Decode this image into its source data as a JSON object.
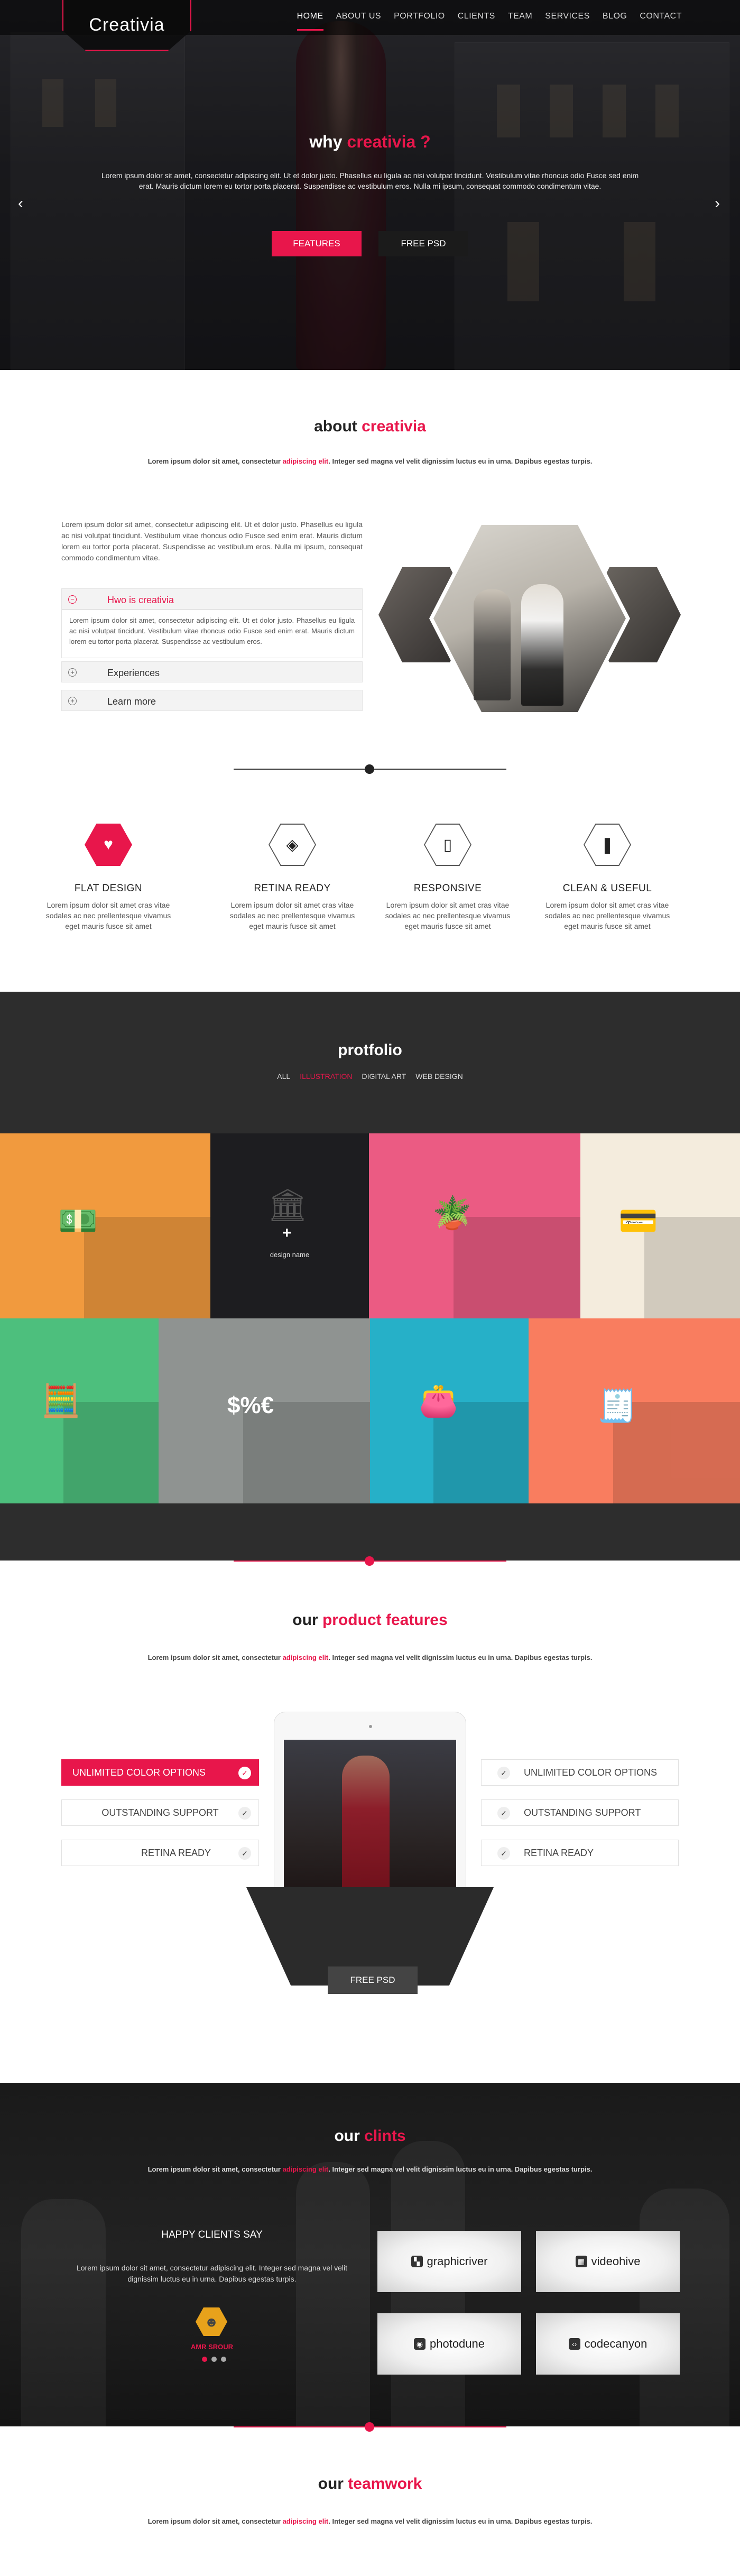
{
  "nav": {
    "logo": "Creativia",
    "items": [
      "HOME",
      "ABOUT US",
      "PORTFOLIO",
      "CLIENTS",
      "TEAM",
      "SERVICES",
      "BLOG",
      "CONTACT"
    ]
  },
  "hero": {
    "title_prefix": "why ",
    "title_accent": "creativia ?",
    "text": "Lorem ipsum dolor sit amet, consectetur adipiscing elit. Ut et dolor justo. Phasellus eu ligula ac nisi volutpat tincidunt. Vestibulum vitae rhoncus odio Fusce sed enim erat. Mauris dictum lorem eu tortor porta placerat. Suspendisse ac vestibulum eros. Nulla mi ipsum, consequat commodo condimentum vitae.",
    "btn_features": "FEATURES",
    "btn_psd": "FREE PSD",
    "arrow_left": "‹",
    "arrow_right": "›"
  },
  "about": {
    "title_prefix": "about ",
    "title_accent": "creativia",
    "sub_a": "Lorem ipsum dolor sit amet, consectetur ",
    "sub_accent": "adipiscing elit",
    "sub_b": ". Integer sed magna vel velit dignissim luctus eu in urna. Dapibus egestas turpis.",
    "paragraph": "Lorem ipsum dolor sit amet, consectetur adipiscing elit. Ut et dolor justo. Phasellus eu ligula ac nisi volutpat tincidunt. Vestibulum vitae rhoncus odio Fusce sed enim erat. Mauris dictum lorem eu tortor porta placerat. Suspendisse ac vestibulum eros. Nulla mi ipsum, consequat commodo condimentum vitae.",
    "accordion": [
      {
        "label": "Hwo is creativia",
        "icon": "⊖"
      },
      {
        "label": "Experiences",
        "icon": "⊕"
      },
      {
        "label": "Learn more",
        "icon": "⊕"
      }
    ],
    "accordion_body": "Lorem ipsum dolor sit amet, consectetur adipiscing elit. Ut et dolor justo. Phasellus eu ligula ac nisi volutpat tincidunt. Vestibulum vitae rhoncus odio Fusce sed enim erat. Mauris dictum lorem eu tortor porta placerat. Suspendisse ac vestibulum eros."
  },
  "features": [
    {
      "title": "FLAT DESIGN",
      "icon": "heart-icon",
      "glyph": "♥",
      "text": "Lorem ipsum dolor sit amet cras vitae sodales ac nec prellentesque vivamus eget mauris fusce sit amet"
    },
    {
      "title": "RETINA READY",
      "icon": "layers-icon",
      "glyph": "◈",
      "text": "Lorem ipsum dolor sit amet cras vitae sodales ac nec prellentesque vivamus eget mauris fusce sit amet"
    },
    {
      "title": "RESPONSIVE",
      "icon": "tablet-icon",
      "glyph": "▯",
      "text": "Lorem ipsum dolor sit amet cras vitae sodales ac nec prellentesque vivamus eget mauris fusce sit amet"
    },
    {
      "title": "CLEAN & USEFUL",
      "icon": "drop-icon",
      "glyph": "❚",
      "text": "Lorem ipsum dolor sit amet cras vitae sodales ac nec prellentesque vivamus eget mauris fusce sit amet"
    }
  ],
  "portfolio": {
    "title": "protfolio",
    "filters": [
      "ALL",
      "ILLUSTRATION",
      "DIGITAL ART",
      "WEB DESIGN"
    ],
    "active_filter": "ILLUSTRATION",
    "hover_label": "design name",
    "hover_plus": "+",
    "tiles": [
      {
        "name": "money-stack",
        "color": "#f19a3e",
        "icon": "money-icon",
        "glyph": "💵"
      },
      {
        "name": "bank",
        "color": "#1d1d20",
        "icon": "bank-icon",
        "glyph": "🏛"
      },
      {
        "name": "money-plant",
        "color": "#eb5b83",
        "icon": "plant-icon",
        "glyph": "🪴"
      },
      {
        "name": "credit-cards",
        "color": "#f4ecdd",
        "icon": "card-icon",
        "glyph": "💳"
      },
      {
        "name": "calculator",
        "color": "#4dbf7d",
        "icon": "calculator-icon",
        "glyph": "🧮"
      },
      {
        "name": "currency-exchange",
        "color": "#8f9391",
        "icon": "exchange-icon",
        "glyph": "$%€"
      },
      {
        "name": "wallet",
        "color": "#26b0c8",
        "icon": "wallet-icon",
        "glyph": "👛"
      },
      {
        "name": "cheque",
        "color": "#f97d5f",
        "icon": "cheque-icon",
        "glyph": "🧾"
      }
    ]
  },
  "product": {
    "title_prefix": "our ",
    "title_accent": "product features",
    "sub_a": "Lorem ipsum dolor sit amet, consectetur ",
    "sub_accent": "adipiscing elit",
    "sub_b": ". Integer sed magna vel velit dignissim luctus eu in urna. Dapibus egestas turpis.",
    "left_options": [
      "UNLIMITED COLOR OPTIONS",
      "OUTSTANDING SUPPORT",
      "RETINA READY"
    ],
    "right_options": [
      "UNLIMITED COLOR OPTIONS",
      "OUTSTANDING SUPPORT",
      "RETINA READY"
    ],
    "check": "✓",
    "btn_psd": "FREE PSD"
  },
  "clients": {
    "title_prefix": "our ",
    "title_accent": "clints",
    "sub_a": "Lorem ipsum dolor sit amet, consectetur ",
    "sub_accent": "adipiscing elit",
    "sub_b": ". Integer sed magna vel velit dignissim luctus eu in urna. Dapibus egestas turpis.",
    "happy": "HAPPY CLIENTS SAY",
    "quote": "Lorem ipsum dolor sit amet, consectetur adipiscing elit. Integer sed magna vel velit dignissim luctus eu in urna. Dapibus egestas turpis.",
    "name": "AMR SROUR",
    "brands": [
      {
        "name": "graphicriver",
        "icon": "graphicriver-icon",
        "glyph": "▚"
      },
      {
        "name": "videohive",
        "icon": "videohive-icon",
        "glyph": "▦"
      },
      {
        "name": "photodune",
        "icon": "photodune-icon",
        "glyph": "◉"
      },
      {
        "name": "codecanyon",
        "icon": "codecanyon-icon",
        "glyph": "‹›"
      }
    ]
  },
  "team": {
    "title_prefix": "our ",
    "title_accent": "teamwork",
    "sub_a": "Lorem ipsum dolor sit amet, consectetur ",
    "sub_accent": "adipiscing elit",
    "sub_b": ". Integer sed magna vel velit dignissim luctus eu in urna. Dapibus egestas turpis."
  },
  "colors": {
    "accent": "#e8164b",
    "dark": "#2d2d2d"
  }
}
